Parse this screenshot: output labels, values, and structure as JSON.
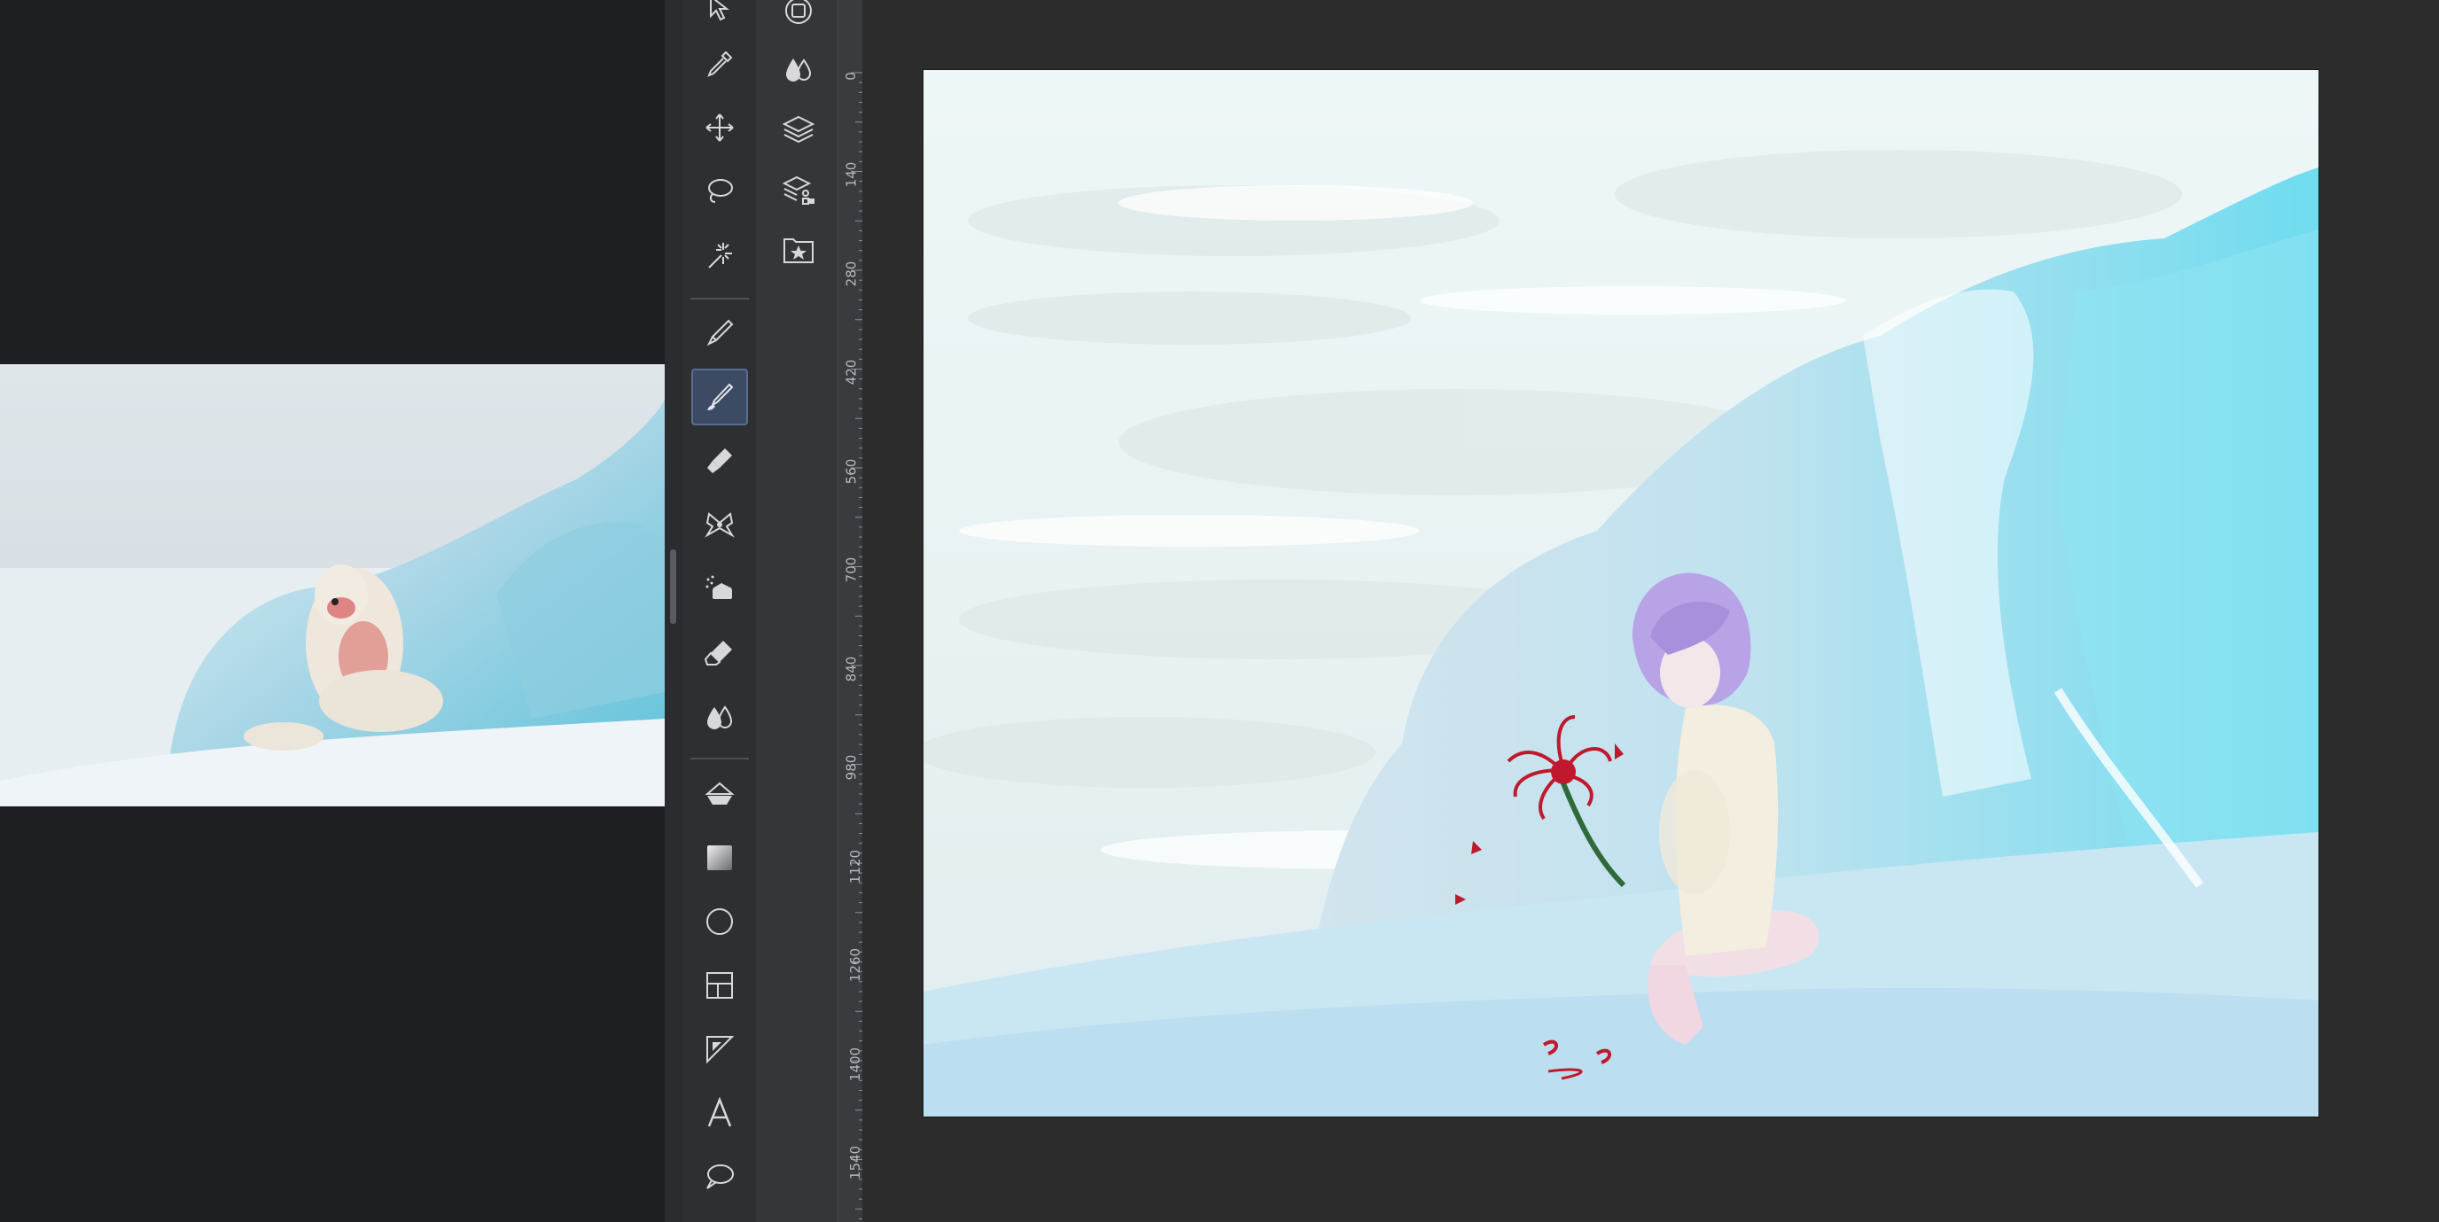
{
  "app": {
    "active_tool": "brush",
    "ruler_ticks": [
      "0",
      "140",
      "280",
      "420",
      "560",
      "700",
      "840",
      "980",
      "1120",
      "1260",
      "1400",
      "1540"
    ]
  },
  "toolbar": {
    "tools": [
      "pointer-tool",
      "eyedropper-tool",
      "move-tool",
      "lasso-tool",
      "magic-wand-tool",
      "pen-tool",
      "brush-tool",
      "marker-tool",
      "ribbon-tool",
      "airbrush-tool",
      "eraser-tool",
      "blend-tool",
      "fill-tool",
      "gradient-tool",
      "ellipse-tool",
      "frame-tool",
      "ruler-tool",
      "text-tool",
      "speech-bubble-tool"
    ]
  },
  "colors": {
    "accent": "#3d4a64",
    "canvas_bg": "#2c2c2c",
    "flower_red": "#c0182c",
    "hair_lavender": "#b7a3e6"
  }
}
